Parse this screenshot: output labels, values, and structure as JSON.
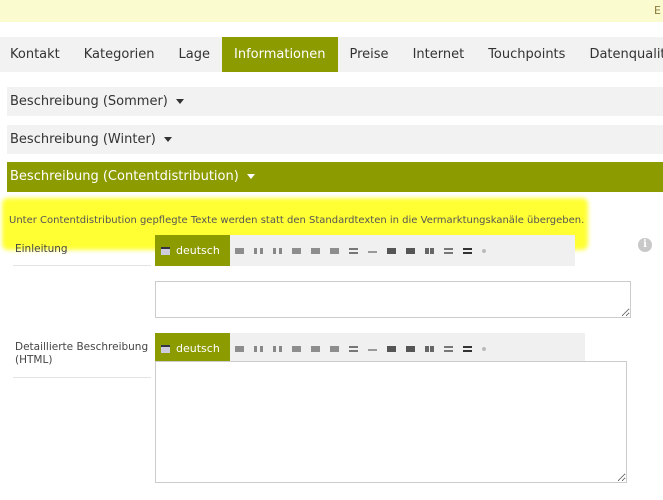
{
  "topbar": {
    "text": "E"
  },
  "tabs": [
    {
      "label": "Kontakt"
    },
    {
      "label": "Kategorien"
    },
    {
      "label": "Lage"
    },
    {
      "label": "Informationen",
      "active": true
    },
    {
      "label": "Preise"
    },
    {
      "label": "Internet"
    },
    {
      "label": "Touchpoints"
    },
    {
      "label": "Datenqualität"
    }
  ],
  "sections": [
    {
      "label": "Beschreibung (Sommer)"
    },
    {
      "label": "Beschreibung (Winter)"
    },
    {
      "label": "Beschreibung (Contentdistribution)"
    }
  ],
  "note": "Unter Contentdistribution gepflegte Texte werden statt den Standardtexten in die Vermarktungskanäle übergeben.",
  "fields": {
    "einleitung": {
      "label": "Einleitung",
      "lang": "deutsch",
      "value": ""
    },
    "detail": {
      "label_line1": "Detaillierte Beschreibung",
      "label_line2": "(HTML)",
      "lang": "deutsch",
      "value": ""
    }
  },
  "icons": {
    "info": "info-icon"
  },
  "colors": {
    "accent": "#8c9b00",
    "highlight": "#ffff33",
    "topbar": "#fbfbd0"
  }
}
